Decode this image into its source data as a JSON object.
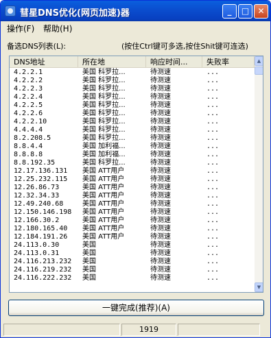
{
  "window": {
    "title": "彗星DNS优化(网页加速)器"
  },
  "title_buttons": {
    "minimize": "_",
    "maximize": "□",
    "close": "✕"
  },
  "menu": [
    {
      "label": "操作(F)"
    },
    {
      "label": "帮助(H)"
    }
  ],
  "list_label": "备选DNS列表(L):",
  "hint": "(按住Ctrl键可多选,按住Shit键可连选)",
  "columns": [
    "DNS地址",
    "所在地",
    "响应时间...",
    "失败率"
  ],
  "rows": [
    {
      "ip": "4.2.2.1",
      "loc": "美国 科罗拉...",
      "resp": "待测速",
      "fail": "..."
    },
    {
      "ip": "4.2.2.2",
      "loc": "美国 科罗拉...",
      "resp": "待测速",
      "fail": "..."
    },
    {
      "ip": "4.2.2.3",
      "loc": "美国 科罗拉...",
      "resp": "待测速",
      "fail": "..."
    },
    {
      "ip": "4.2.2.4",
      "loc": "美国 科罗拉...",
      "resp": "待测速",
      "fail": "..."
    },
    {
      "ip": "4.2.2.5",
      "loc": "美国 科罗拉...",
      "resp": "待测速",
      "fail": "..."
    },
    {
      "ip": "4.2.2.6",
      "loc": "美国 科罗拉...",
      "resp": "待测速",
      "fail": "..."
    },
    {
      "ip": "4.2.2.10",
      "loc": "美国 科罗拉...",
      "resp": "待测速",
      "fail": "..."
    },
    {
      "ip": "4.4.4.4",
      "loc": "美国 科罗拉...",
      "resp": "待测速",
      "fail": "..."
    },
    {
      "ip": "8.2.208.5",
      "loc": "美国 科罗拉...",
      "resp": "待测速",
      "fail": "..."
    },
    {
      "ip": "8.8.4.4",
      "loc": "美国 加利福...",
      "resp": "待测速",
      "fail": "..."
    },
    {
      "ip": "8.8.8.8",
      "loc": "美国 加利福...",
      "resp": "待测速",
      "fail": "..."
    },
    {
      "ip": "8.8.192.35",
      "loc": "美国 科罗拉...",
      "resp": "待测速",
      "fail": "..."
    },
    {
      "ip": "12.17.136.131",
      "loc": "美国 ATT用户",
      "resp": "待测速",
      "fail": "..."
    },
    {
      "ip": "12.25.232.115",
      "loc": "美国 ATT用户",
      "resp": "待测速",
      "fail": "..."
    },
    {
      "ip": "12.26.86.73",
      "loc": "美国 ATT用户",
      "resp": "待测速",
      "fail": "..."
    },
    {
      "ip": "12.32.34.33",
      "loc": "美国 ATT用户",
      "resp": "待测速",
      "fail": "..."
    },
    {
      "ip": "12.49.240.68",
      "loc": "美国 ATT用户",
      "resp": "待测速",
      "fail": "..."
    },
    {
      "ip": "12.150.146.198",
      "loc": "美国 ATT用户",
      "resp": "待测速",
      "fail": "..."
    },
    {
      "ip": "12.166.30.2",
      "loc": "美国 ATT用户",
      "resp": "待测速",
      "fail": "..."
    },
    {
      "ip": "12.180.165.40",
      "loc": "美国 ATT用户",
      "resp": "待测速",
      "fail": "..."
    },
    {
      "ip": "12.184.191.26",
      "loc": "美国 ATT用户",
      "resp": "待测速",
      "fail": "..."
    },
    {
      "ip": "24.113.0.30",
      "loc": "美国",
      "resp": "待测速",
      "fail": "..."
    },
    {
      "ip": "24.113.0.31",
      "loc": "美国",
      "resp": "待测速",
      "fail": "..."
    },
    {
      "ip": "24.116.213.232",
      "loc": "美国",
      "resp": "待测速",
      "fail": "..."
    },
    {
      "ip": "24.116.219.232",
      "loc": "美国",
      "resp": "待测速",
      "fail": "..."
    },
    {
      "ip": "24.116.222.232",
      "loc": "美国",
      "resp": "待测速",
      "fail": "..."
    }
  ],
  "primary_button": {
    "label": "一键完成(推荐)(A)"
  },
  "status": {
    "count": "1919"
  }
}
